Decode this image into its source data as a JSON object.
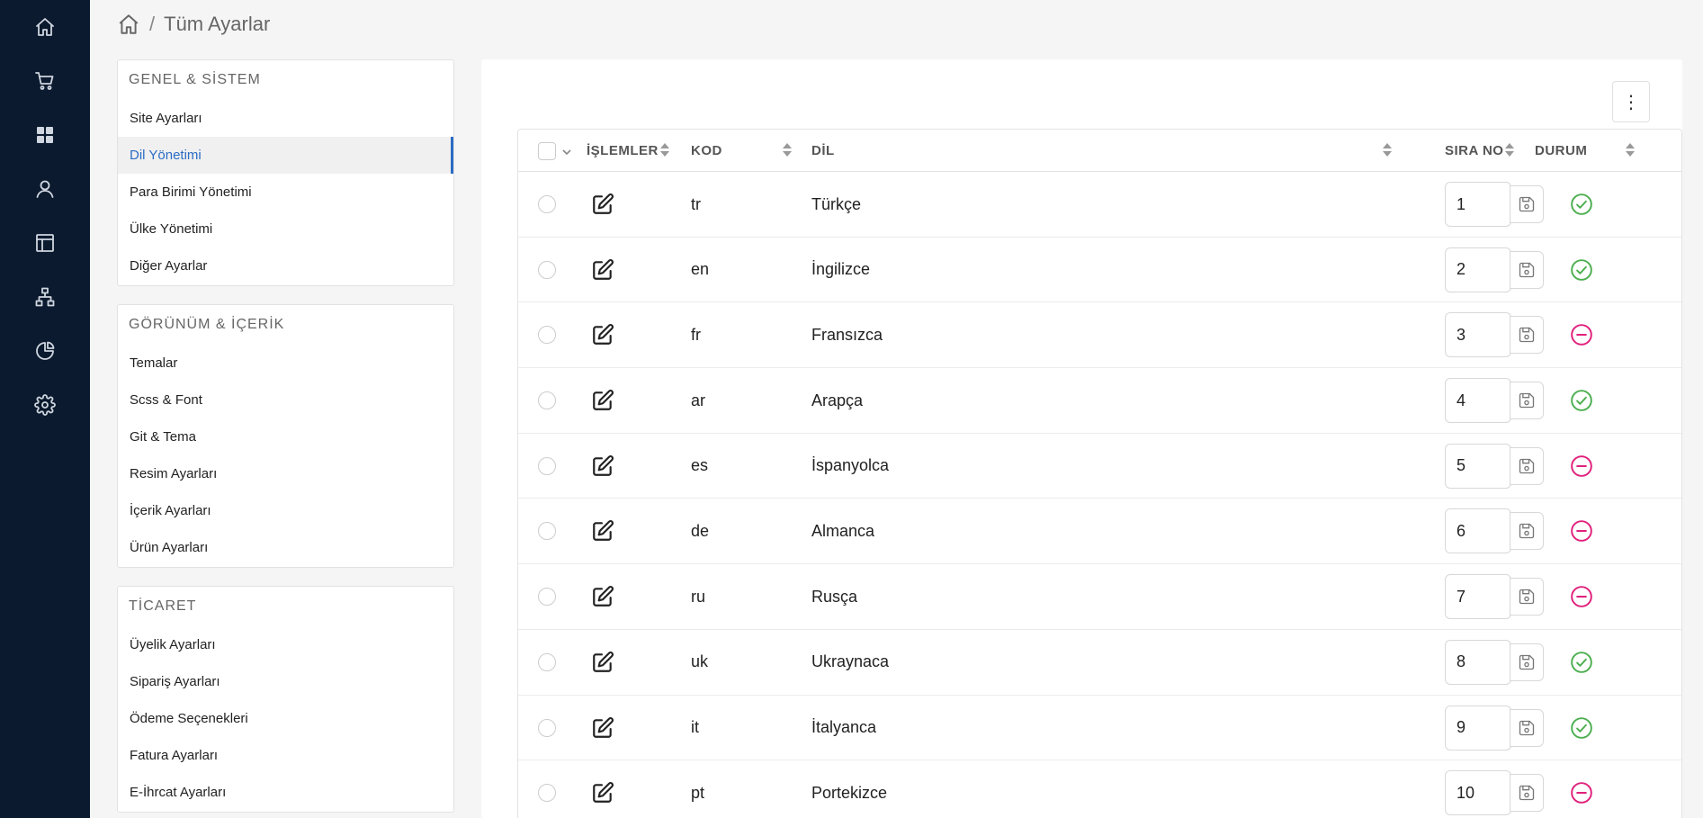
{
  "nav_rail": {
    "items": [
      {
        "icon": "home-icon"
      },
      {
        "icon": "cart-icon"
      },
      {
        "icon": "grid-icon"
      },
      {
        "icon": "user-icon"
      },
      {
        "icon": "layout-icon"
      },
      {
        "icon": "sitemap-icon"
      },
      {
        "icon": "pie-chart-icon"
      },
      {
        "icon": "gear-icon"
      }
    ]
  },
  "breadcrumb": {
    "separator": "/",
    "current": "Tüm Ayarlar"
  },
  "settings_menu": {
    "sections": [
      {
        "title": "GENEL & SİSTEM",
        "items": [
          "Site Ayarları",
          "Dil Yönetimi",
          "Para Birimi Yönetimi",
          "Ülke Yönetimi",
          "Diğer Ayarlar"
        ],
        "active_index": 1
      },
      {
        "title": "GÖRÜNÜM & İÇERİK",
        "items": [
          "Temalar",
          "Scss & Font",
          "Git & Tema",
          "Resim Ayarları",
          "İçerik Ayarları",
          "Ürün Ayarları"
        ]
      },
      {
        "title": "TİCARET",
        "items": [
          "Üyelik Ayarları",
          "Sipariş Ayarları",
          "Ödeme Seçenekleri",
          "Fatura Ayarları",
          "E-İhrcat Ayarları"
        ]
      }
    ]
  },
  "more_button": {
    "label": "⋮"
  },
  "table": {
    "headers": {
      "actions": "İŞLEMLER",
      "code": "KOD",
      "language": "DİL",
      "order": "SIRA NO",
      "status": "DURUM"
    },
    "rows": [
      {
        "code": "tr",
        "language": "Türkçe",
        "order": "1",
        "status": "active"
      },
      {
        "code": "en",
        "language": "İngilizce",
        "order": "2",
        "status": "active"
      },
      {
        "code": "fr",
        "language": "Fransızca",
        "order": "3",
        "status": "passive"
      },
      {
        "code": "ar",
        "language": "Arapça",
        "order": "4",
        "status": "active"
      },
      {
        "code": "es",
        "language": "İspanyolca",
        "order": "5",
        "status": "passive"
      },
      {
        "code": "de",
        "language": "Almanca",
        "order": "6",
        "status": "passive"
      },
      {
        "code": "ru",
        "language": "Rusça",
        "order": "7",
        "status": "passive"
      },
      {
        "code": "uk",
        "language": "Ukraynaca",
        "order": "8",
        "status": "active"
      },
      {
        "code": "it",
        "language": "İtalyanca",
        "order": "9",
        "status": "active"
      },
      {
        "code": "pt",
        "language": "Portekizce",
        "order": "10",
        "status": "passive"
      }
    ]
  },
  "colors": {
    "rail_bg": "#0b1a2e",
    "active_menu": "#2b6cc4",
    "status_active": "#4caf50",
    "status_passive": "#e0207c"
  }
}
